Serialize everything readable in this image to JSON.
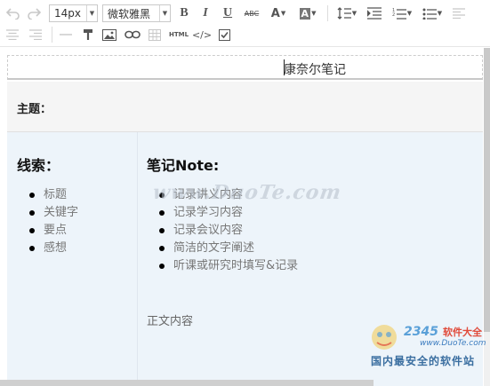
{
  "toolbar": {
    "font_size": "14px",
    "font_family": "微软雅黑",
    "abc_label": "ABC",
    "html_label": "HTML",
    "code_label": "</>"
  },
  "editor": {
    "title": "康奈尔笔记",
    "topic_label": "主题：",
    "cue_heading": "线索：",
    "cue_items": [
      "标题",
      "关键字",
      "要点",
      "感想"
    ],
    "notes_heading": "笔记Note:",
    "notes_items": [
      "记录讲义内容",
      "记录学习内容",
      "记录会议内容",
      "简洁的文字阐述",
      "听课或研究时填写&记录"
    ],
    "body_text": "正文内容"
  },
  "watermarks": {
    "duote": "www.DuoTe.com",
    "logo_number": "2345",
    "logo_name": "软件大全",
    "logo_url": "www.DuoTe.com",
    "logo_tagline": "国内最安全的软件站"
  },
  "colors": {
    "cell_bg": "#edf4fa",
    "topic_bg": "#f5f5f5",
    "bullet_text": "#777777"
  }
}
